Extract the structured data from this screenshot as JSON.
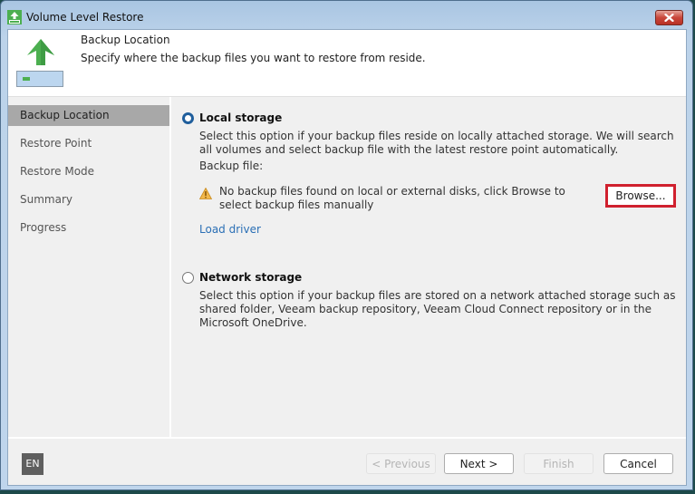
{
  "window": {
    "title": "Volume Level Restore",
    "app_icon": "volume-restore-icon",
    "close_icon": "close-icon"
  },
  "header": {
    "title": "Backup Location",
    "subtitle": "Specify where the backup files you want to restore from reside.",
    "icon": "upload-arrow-disk-icon"
  },
  "sidebar": {
    "items": [
      {
        "label": "Backup Location",
        "active": true
      },
      {
        "label": "Restore Point",
        "active": false
      },
      {
        "label": "Restore Mode",
        "active": false
      },
      {
        "label": "Summary",
        "active": false
      },
      {
        "label": "Progress",
        "active": false
      }
    ]
  },
  "content": {
    "local": {
      "label": "Local storage",
      "selected": true,
      "description": "Select this option if your backup files reside on locally attached storage. We will search all volumes and select backup file with the latest restore point automatically.",
      "backup_file_label": "Backup file:",
      "warning_icon": "warning-icon",
      "warning_text": "No backup files found on local or external disks, click Browse to select backup files manually",
      "browse_label": "Browse...",
      "load_driver_label": "Load driver"
    },
    "network": {
      "label": "Network storage",
      "selected": false,
      "description": "Select this option if your backup files are stored on a network attached storage such as shared folder, Veeam backup repository, Veeam Cloud Connect repository or in the Microsoft OneDrive."
    }
  },
  "footer": {
    "language": "EN",
    "previous_label": "< Previous",
    "next_label": "Next >",
    "finish_label": "Finish",
    "cancel_label": "Cancel"
  },
  "colors": {
    "accent": "#1f5e9c",
    "link": "#2a6fb5",
    "highlight": "#d0202e",
    "icon_green": "#4caf50"
  }
}
